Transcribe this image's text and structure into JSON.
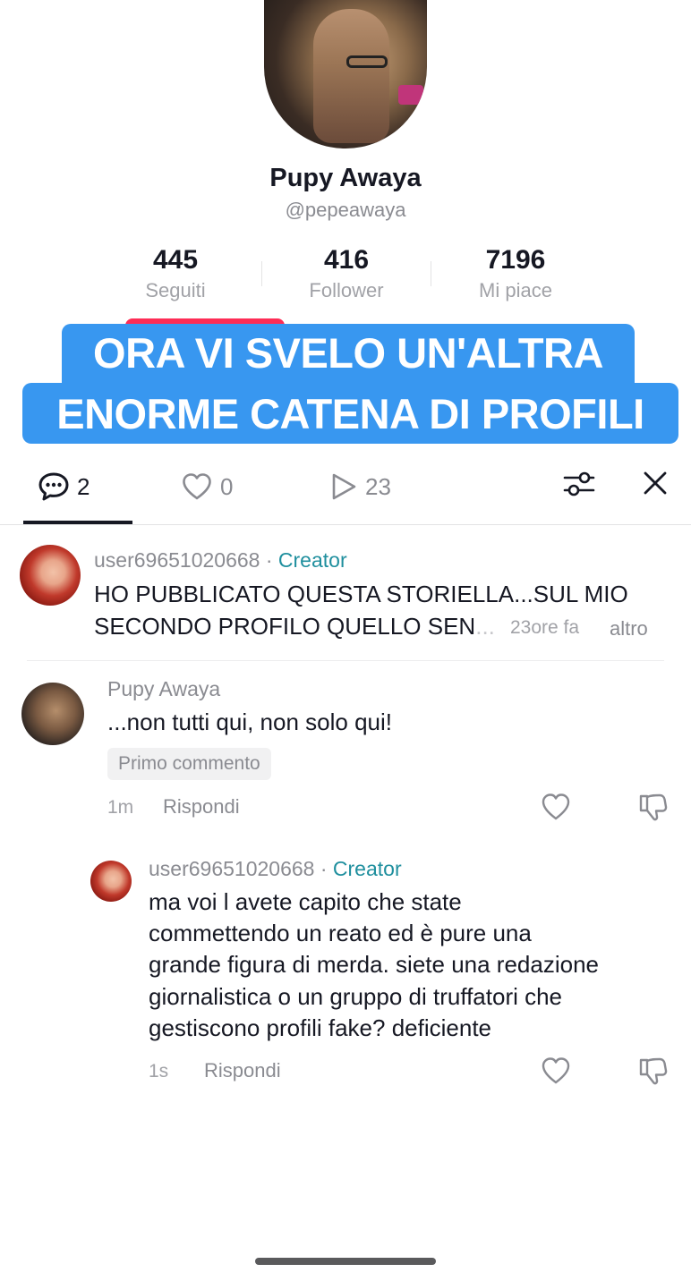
{
  "profile": {
    "name": "Pupy Awaya",
    "handle": "@pepeawaya",
    "stats": [
      {
        "value": "445",
        "label": "Seguiti"
      },
      {
        "value": "416",
        "label": "Follower"
      },
      {
        "value": "7196",
        "label": "Mi piace"
      }
    ]
  },
  "banner": {
    "line1": "ORA VI SVELO UN'ALTRA",
    "line2": "ENORME CATENA DI PROFILI",
    "color": "#3897f0"
  },
  "tabs": {
    "comments": {
      "icon": "comment-icon",
      "count": "2"
    },
    "likes": {
      "icon": "heart-icon",
      "count": "0"
    },
    "plays": {
      "icon": "play-icon",
      "count": "23"
    },
    "filter_icon": "sliders-icon",
    "close_icon": "close-icon"
  },
  "comments": [
    {
      "username": "user69651020668",
      "badge": "Creator",
      "line1": "HO PUBBLICATO QUESTA STORIELLA...SUL MIO",
      "line2": "SECONDO PROFILO QUELLO SEN",
      "ellipsis": "...",
      "time": "23ore fa",
      "more": "altro"
    },
    {
      "username": "Pupy Awaya",
      "text": "...non tutti qui, non solo qui!",
      "pill": "Primo commento",
      "time": "1m",
      "reply": "Rispondi"
    },
    {
      "username": "user69651020668",
      "badge": "Creator",
      "lines": [
        "ma voi l avete capito che state",
        "commettendo un reato ed è pure una",
        "grande figura di merda. siete una redazione",
        "giornalistica o un gruppo di truffatori che",
        "gestiscono profili fake? deficiente"
      ],
      "time": "1s",
      "reply": "Rispondi"
    }
  ],
  "colors": {
    "accent_pink": "#fe2c55",
    "creator_teal": "#1f8f9e"
  }
}
